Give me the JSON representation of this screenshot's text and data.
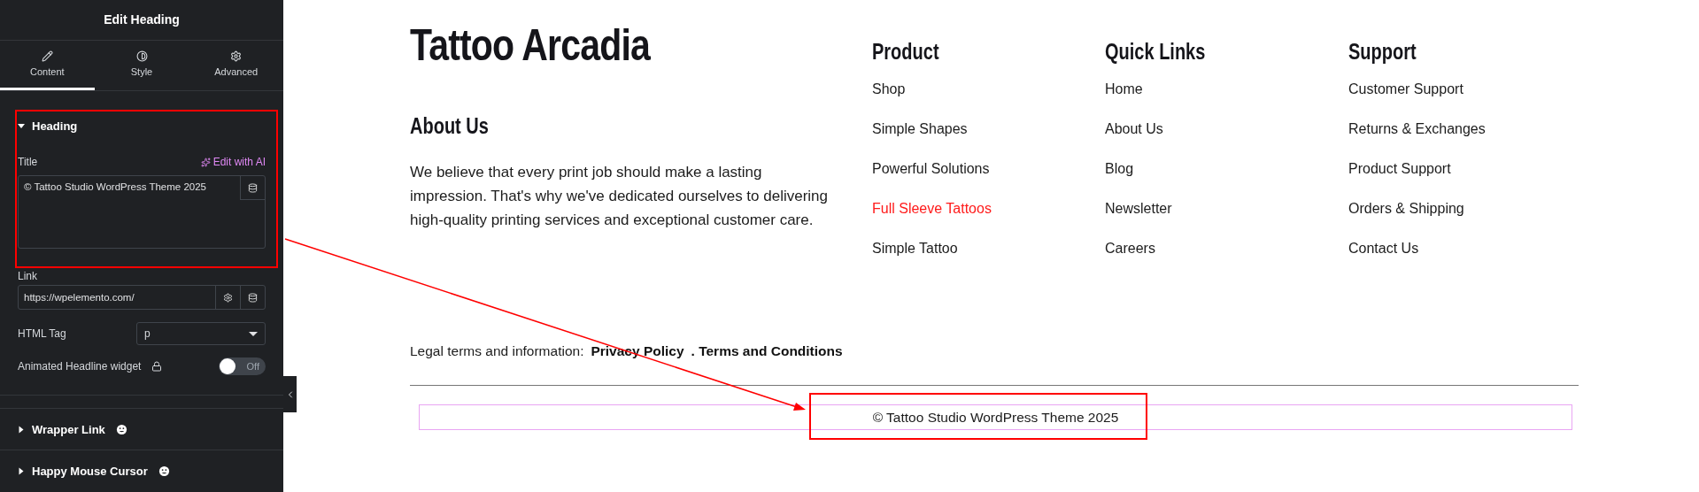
{
  "panel": {
    "title": "Edit Heading",
    "tabs": [
      {
        "label": "Content",
        "selected": true
      },
      {
        "label": "Style",
        "selected": false
      },
      {
        "label": "Advanced",
        "selected": false
      }
    ],
    "section": {
      "label": "Heading",
      "expanded": true,
      "title_label": "Title",
      "ai_link": "Edit with AI",
      "title_value": "© Tattoo Studio WordPress Theme 2025",
      "link_label": "Link",
      "link_value": "https://wpelemento.com/",
      "tag_label": "HTML Tag",
      "tag_value": "p",
      "animated_label": "Animated Headline widget",
      "animated_on": false,
      "toggle_text": "Off"
    },
    "collapsed_sections": [
      {
        "label": "Wrapper Link",
        "expanded": false
      },
      {
        "label": "Happy Mouse Cursor",
        "expanded": false
      }
    ]
  },
  "footer": {
    "brand": "Tattoo Arcadia",
    "about_heading": "About Us",
    "about_text": "We believe that every print job should make a lasting impression. That's why we've dedicated ourselves to delivering high-quality printing services and exceptional customer care.",
    "columns": [
      {
        "heading": "Product",
        "links": [
          {
            "label": "Shop",
            "selected": false
          },
          {
            "label": "Simple Shapes",
            "selected": false
          },
          {
            "label": "Powerful Solutions",
            "selected": false
          },
          {
            "label": "Full Sleeve Tattoos",
            "selected": true
          },
          {
            "label": "Simple Tattoo",
            "selected": false
          }
        ]
      },
      {
        "heading": "Quick Links",
        "links": [
          {
            "label": "Home",
            "selected": false
          },
          {
            "label": "About Us",
            "selected": false
          },
          {
            "label": "Blog",
            "selected": false
          },
          {
            "label": "Newsletter",
            "selected": false
          },
          {
            "label": "Careers",
            "selected": false
          }
        ]
      },
      {
        "heading": "Support",
        "links": [
          {
            "label": "Customer Support",
            "selected": false
          },
          {
            "label": "Returns & Exchanges",
            "selected": false
          },
          {
            "label": "Product Support",
            "selected": false
          },
          {
            "label": "Orders & Shipping",
            "selected": false
          },
          {
            "label": "Contact Us",
            "selected": false
          }
        ]
      }
    ],
    "legal_label": "Legal terms and information:",
    "legal_links": [
      "Privacy Policy",
      ". Terms and Conditions"
    ],
    "copyright": "© Tattoo Studio WordPress Theme 2025"
  }
}
